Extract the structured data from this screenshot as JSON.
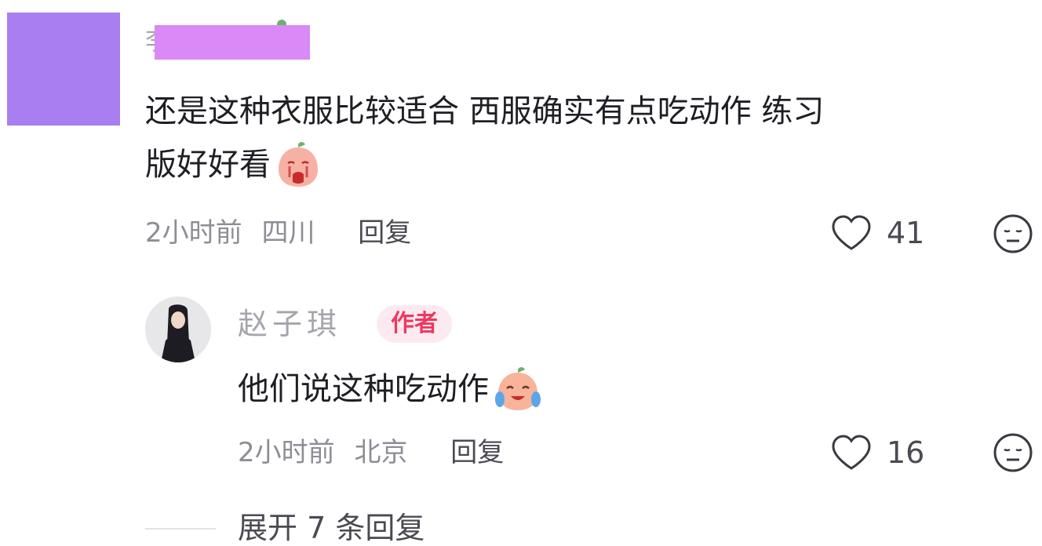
{
  "comments": [
    {
      "username_partial": "李",
      "text_line1": "还是这种衣服比较适合 西服确实有点吃动作 练习",
      "text_line2": "版好好看",
      "time": "2小时前",
      "location": "四川",
      "reply_label": "回复",
      "like_count": "41",
      "emoji_icon": "crying-face-emoji"
    }
  ],
  "reply": {
    "username": "赵子琪",
    "badge": "作者",
    "text": "他们说这种吃动作",
    "time": "2小时前",
    "location": "北京",
    "reply_label": "回复",
    "like_count": "16",
    "emoji_icon": "laughing-crying-emoji"
  },
  "expand": {
    "label": "展开 7 条回复"
  },
  "colors": {
    "redaction_avatar": "#a97ef0",
    "redaction_name": "#d98af6",
    "author_badge_bg": "#fdeaf0",
    "author_badge_text": "#f0385f"
  }
}
